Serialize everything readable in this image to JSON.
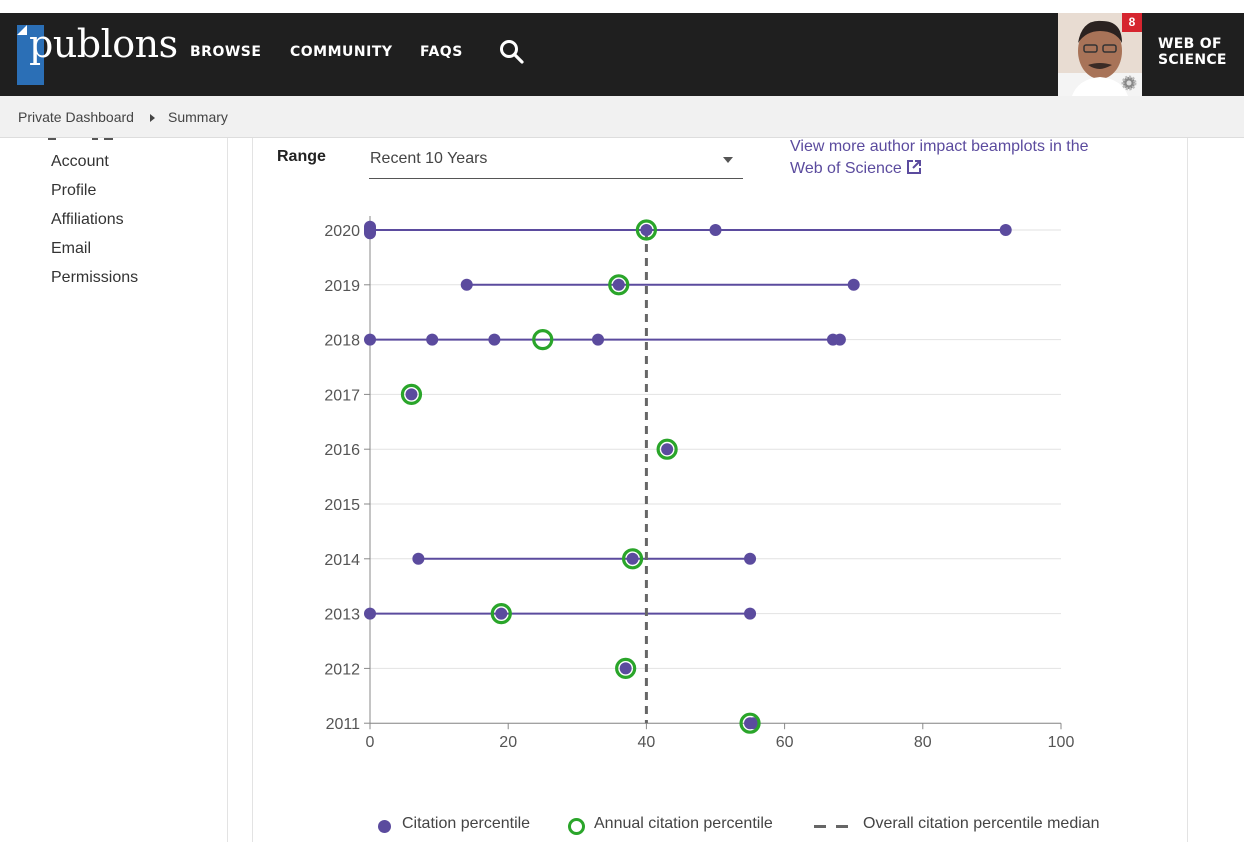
{
  "header": {
    "logo_text": "publons",
    "nav": [
      "BROWSE",
      "COMMUNITY",
      "FAQS"
    ],
    "notification_count": "8",
    "wos_line1": "WEB OF",
    "wos_line2": "SCIENCE"
  },
  "breadcrumb": {
    "items": [
      "Private Dashboard",
      "Summary"
    ]
  },
  "sidebar": {
    "items": [
      "Account",
      "Profile",
      "Affiliations",
      "Email",
      "Permissions"
    ]
  },
  "controls": {
    "range_label": "Range",
    "range_value": "Recent 10 Years",
    "wos_link": "View more author impact beamplots in the Web of Science"
  },
  "chart_data": {
    "type": "scatter",
    "x_range": [
      0,
      100
    ],
    "x_ticks": [
      0,
      20,
      40,
      60,
      80,
      100
    ],
    "y_categories": [
      "2020",
      "2019",
      "2018",
      "2017",
      "2016",
      "2015",
      "2014",
      "2013",
      "2012",
      "2011"
    ],
    "grid": true,
    "median": 40,
    "series": [
      {
        "name": "Citation percentile",
        "color": "#5b4b9e",
        "points": [
          {
            "year": "2020",
            "values": [
              0,
              0,
              0,
              0,
              0,
              40,
              50,
              92
            ]
          },
          {
            "year": "2019",
            "values": [
              14,
              36,
              70
            ]
          },
          {
            "year": "2018",
            "values": [
              0,
              9,
              18,
              33,
              67,
              68
            ]
          },
          {
            "year": "2017",
            "values": [
              6
            ]
          },
          {
            "year": "2016",
            "values": [
              43
            ]
          },
          {
            "year": "2015",
            "values": []
          },
          {
            "year": "2014",
            "values": [
              7,
              38,
              55
            ]
          },
          {
            "year": "2013",
            "values": [
              0,
              19,
              55
            ]
          },
          {
            "year": "2012",
            "values": [
              37
            ]
          },
          {
            "year": "2011",
            "values": [
              55,
              55.5
            ]
          }
        ]
      },
      {
        "name": "Annual citation percentile",
        "color": "#2aa52a",
        "points": [
          {
            "year": "2020",
            "value": 40
          },
          {
            "year": "2019",
            "value": 36
          },
          {
            "year": "2018",
            "value": 25
          },
          {
            "year": "2017",
            "value": 6
          },
          {
            "year": "2016",
            "value": 43
          },
          {
            "year": "2014",
            "value": 38
          },
          {
            "year": "2013",
            "value": 19
          },
          {
            "year": "2012",
            "value": 37
          },
          {
            "year": "2011",
            "value": 55
          }
        ]
      },
      {
        "name": "Overall citation percentile median",
        "color": "#666666",
        "value": 40
      }
    ]
  }
}
